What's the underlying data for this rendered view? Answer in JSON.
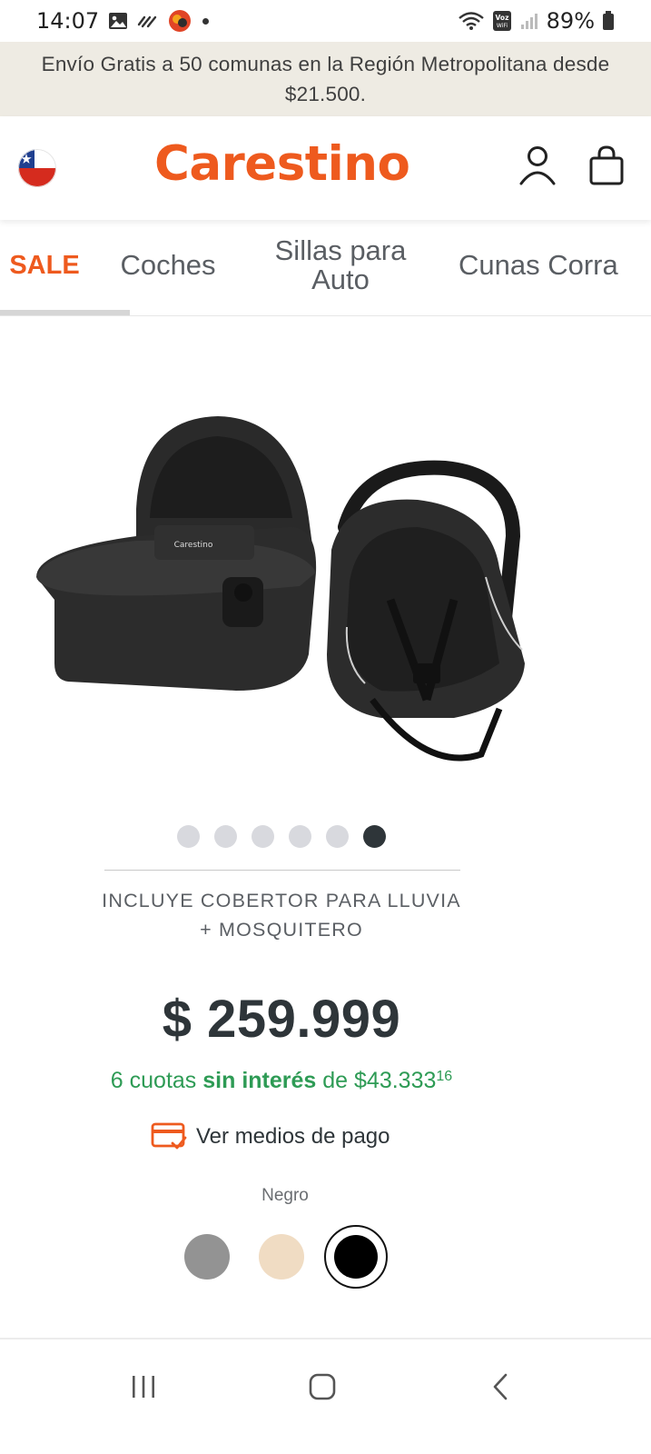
{
  "status_bar": {
    "time": "14:07",
    "battery": "89%",
    "volte_label": "Voz WiFi",
    "icons": [
      "image-icon",
      "signal-squiggle-icon",
      "app-badge-icon",
      "notification-dot",
      "wifi-icon",
      "volte-icon",
      "cell-signal-icon",
      "battery-icon"
    ]
  },
  "promo": {
    "text": "Envío Gratis a 50 comunas en la Región Metropolitana desde $21.500."
  },
  "header": {
    "logo": "Carestino",
    "flag": "chile-flag-icon",
    "user_icon": "user-icon",
    "cart_icon": "shopping-bag-icon"
  },
  "tabs": [
    {
      "label": "SALE",
      "active": true
    },
    {
      "label": "Coches"
    },
    {
      "label": "Sillas para Auto"
    },
    {
      "label": "Cunas Corra"
    }
  ],
  "product": {
    "image_brand_label": "Carestino",
    "carousel": {
      "total": 6,
      "active_index": 5
    },
    "feature_text": "INCLUYE COBERTOR PARA LLUVIA + MOSQUITERO",
    "price": "$ 259.999",
    "installments": {
      "prefix": "6 cuotas ",
      "emphasis": "sin interés",
      "middle": " de $43.333",
      "cents": "16"
    },
    "payment_link": "Ver medios de pago",
    "color_label": "Negro",
    "colors": [
      {
        "name": "gray",
        "hex": "#939393"
      },
      {
        "name": "beige",
        "hex": "#f0dcc3"
      },
      {
        "name": "black",
        "hex": "#000000",
        "selected": true
      }
    ]
  },
  "colors": {
    "brand_orange": "#ee5a1e",
    "installment_green": "#2e9b55",
    "promo_bg": "#eeebe3",
    "dark_text": "#2e3539"
  },
  "nav": {
    "recents": "recents-icon",
    "home": "home-icon",
    "back": "back-icon"
  }
}
